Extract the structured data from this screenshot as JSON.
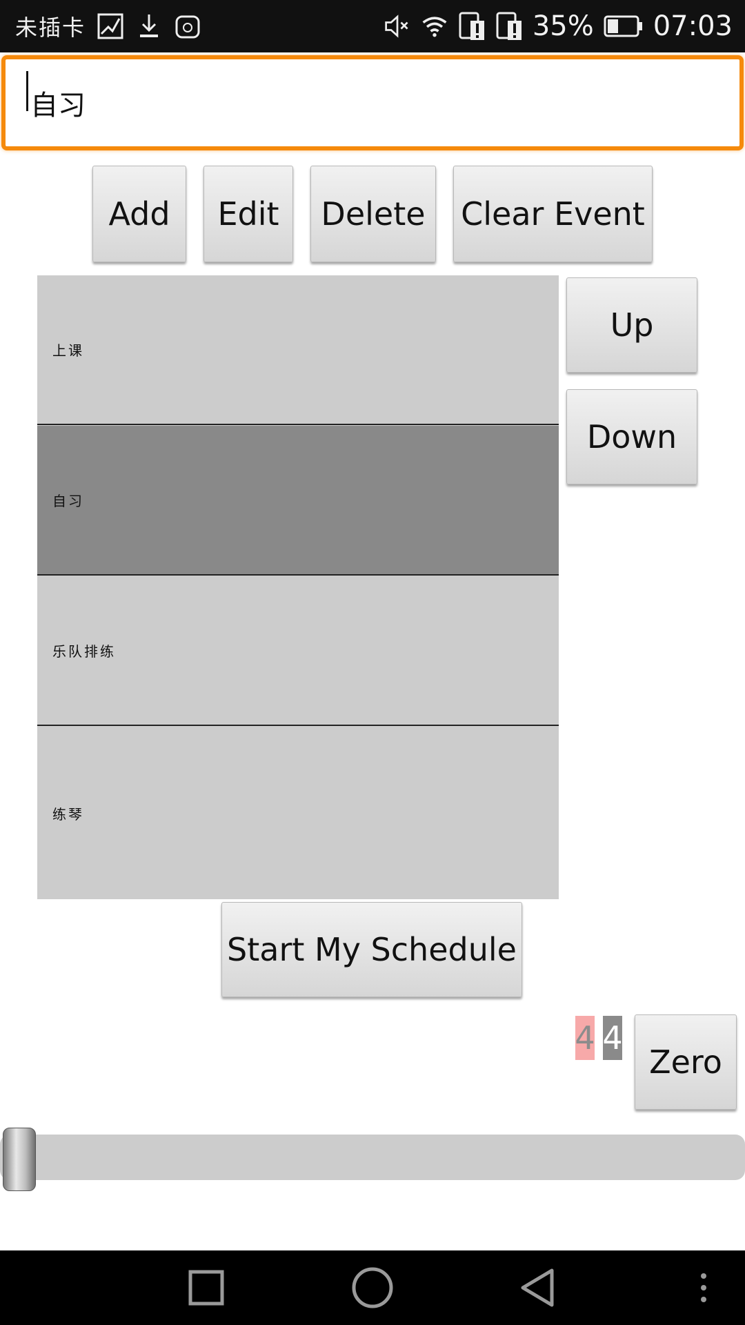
{
  "status_bar": {
    "carrier": "未插卡",
    "battery_percent": "35%",
    "time": "07:03",
    "icons": [
      "image-icon",
      "download-icon",
      "huawei-icon",
      "mute-icon",
      "wifi-icon",
      "sim1-alert-icon",
      "sim2-alert-icon",
      "battery-icon"
    ]
  },
  "event_input": {
    "value": "自习"
  },
  "toolbar": {
    "add_label": "Add",
    "edit_label": "Edit",
    "delete_label": "Delete",
    "clear_label": "Clear Event"
  },
  "events": [
    {
      "label": "上课",
      "selected": false
    },
    {
      "label": "自习",
      "selected": true
    },
    {
      "label": "乐队排练",
      "selected": false
    },
    {
      "label": "练琴",
      "selected": false
    }
  ],
  "reorder": {
    "up_label": "Up",
    "down_label": "Down"
  },
  "start_label": "Start My Schedule",
  "counters": {
    "first": "4",
    "second": "4"
  },
  "zero_label": "Zero",
  "slider": {
    "value_fraction": 0.0
  },
  "navbar": {
    "icons": [
      "recents-icon",
      "home-icon",
      "back-icon",
      "menu-icon"
    ]
  },
  "colors": {
    "accent_border": "#f58a0c",
    "list_bg": "#cccccc",
    "list_selected": "#898989"
  }
}
